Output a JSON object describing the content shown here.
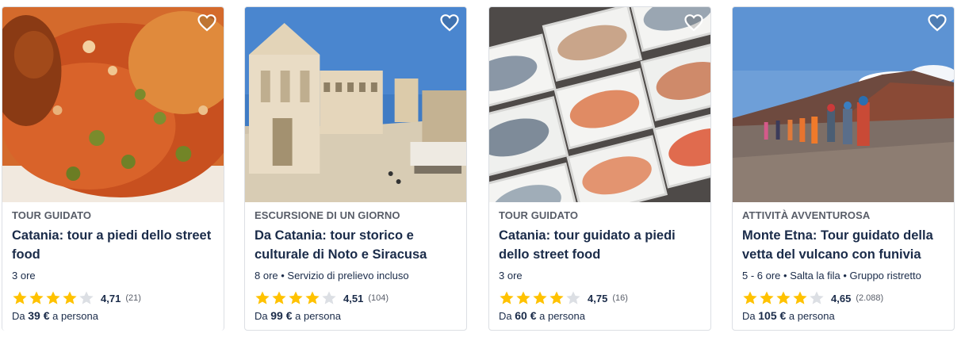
{
  "colors": {
    "star_fill": "#ffc200",
    "star_empty": "#dcdfe4",
    "title": "#1a2b49",
    "category": "#585d68"
  },
  "cards": [
    {
      "image_icon": "arancini-food-photo",
      "category": "TOUR GUIDATO",
      "title": "Catania: tour a piedi dello street food",
      "meta": "3 ore",
      "rating": 4.71,
      "stars": 4,
      "score": "4,71",
      "reviews": "(21)",
      "price_prefix": "Da",
      "price_amount": "39 €",
      "price_suffix": "a persona"
    },
    {
      "image_icon": "siracusa-square-photo",
      "category": "ESCURSIONE DI UN GIORNO",
      "title": "Da Catania: tour storico e culturale di Noto e Siracusa",
      "meta": "8 ore • Servizio di prelievo incluso",
      "rating": 4.51,
      "stars": 4,
      "score": "4,51",
      "reviews": "(104)",
      "price_prefix": "Da",
      "price_amount": "99 €",
      "price_suffix": "a persona"
    },
    {
      "image_icon": "fish-market-photo",
      "category": "TOUR GUIDATO",
      "title": "Catania: tour guidato a piedi dello street food",
      "meta": "3 ore",
      "rating": 4.75,
      "stars": 4,
      "score": "4,75",
      "reviews": "(16)",
      "price_prefix": "Da",
      "price_amount": "60 €",
      "price_suffix": "a persona"
    },
    {
      "image_icon": "etna-hikers-photo",
      "category": "ATTIVITÀ AVVENTUROSA",
      "title": "Monte Etna: Tour guidato della vetta del vulcano con funivia",
      "meta": "5 - 6 ore • Salta la fila • Gruppo ristretto",
      "rating": 4.65,
      "stars": 4,
      "score": "4,65",
      "reviews": "(2.088)",
      "price_prefix": "Da",
      "price_amount": "105 €",
      "price_suffix": "a persona"
    }
  ]
}
